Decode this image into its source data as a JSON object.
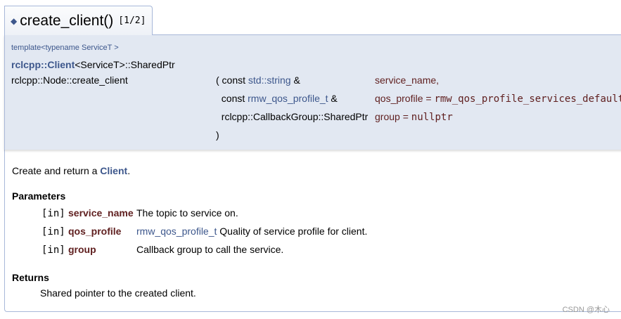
{
  "title": {
    "bullet": "◆",
    "function": "create_client()",
    "overload": "[1/2]"
  },
  "proto": {
    "template": "template<typename ServiceT >",
    "return_link": "rclcpp::Client",
    "return_rest": "<ServiceT>::SharedPtr",
    "name": "rclcpp::Node::create_client",
    "params": [
      {
        "prefix": "( const ",
        "type_link": "std::string",
        "suffix": " &",
        "name": "service_name,",
        "default": ""
      },
      {
        "prefix": "  const ",
        "type_link": "rmw_qos_profile_t",
        "suffix": " &",
        "name": "qos_profile = ",
        "default": "rmw_qos_profile_services_default"
      },
      {
        "prefix": "  rclcpp::CallbackGroup::SharedPtr",
        "type_link": "",
        "suffix": "",
        "name": "group = ",
        "default": "nullptr"
      },
      {
        "prefix": ")",
        "type_link": "",
        "suffix": "",
        "name": "",
        "default": ""
      }
    ]
  },
  "doc": {
    "brief_prefix": "Create and return a ",
    "brief_link": "Client",
    "brief_suffix": ".",
    "parameters_heading": "Parameters",
    "parameters": [
      {
        "dir": "[in]",
        "name": "service_name",
        "desc_link": "",
        "desc": "The topic to service on."
      },
      {
        "dir": "[in]",
        "name": "qos_profile",
        "desc_link": "rmw_qos_profile_t",
        "desc": " Quality of service profile for client."
      },
      {
        "dir": "[in]",
        "name": "group",
        "desc_link": "",
        "desc": "Callback group to call the service."
      }
    ],
    "returns_heading": "Returns",
    "returns_text": "Shared pointer to the created client."
  },
  "watermark": "CSDN @木心"
}
